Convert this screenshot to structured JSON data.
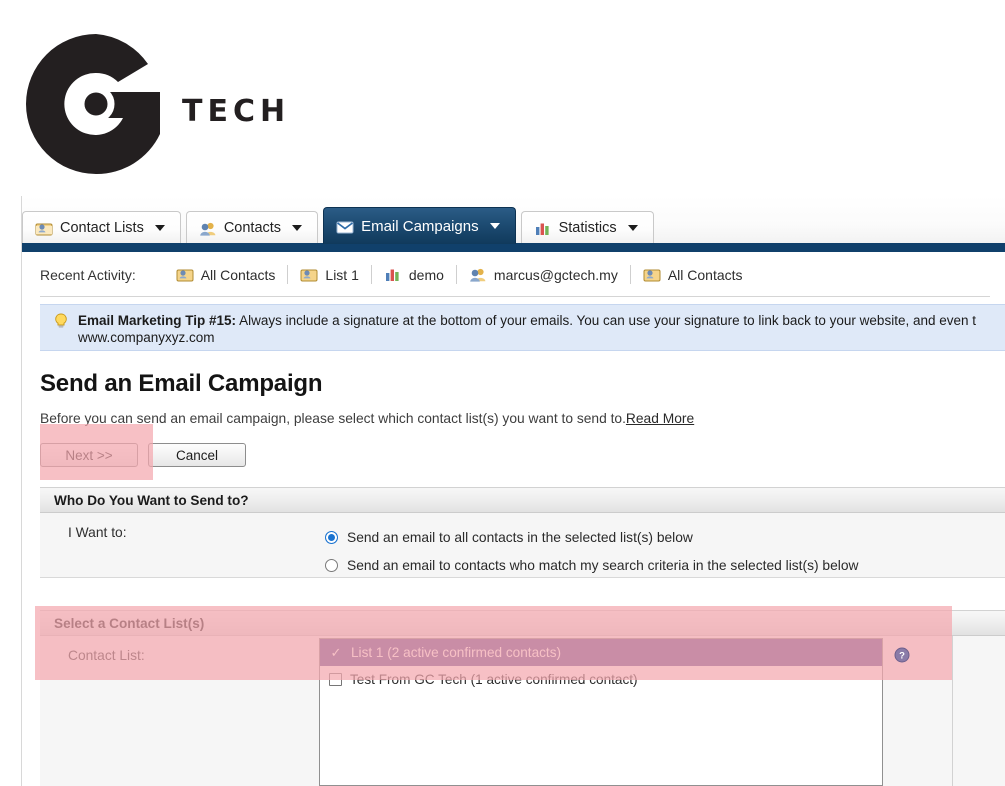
{
  "brand": {
    "logo_text": "TECH",
    "logo_icon": "gtech-g-logo-icon"
  },
  "tabs": [
    {
      "label": "Contact Lists",
      "icon": "contact-list-icon",
      "active": false
    },
    {
      "label": "Contacts",
      "icon": "contacts-icon",
      "active": false
    },
    {
      "label": "Email Campaigns",
      "icon": "envelope-icon",
      "active": true
    },
    {
      "label": "Statistics",
      "icon": "bar-chart-icon",
      "active": false
    }
  ],
  "recent_activity": {
    "label": "Recent Activity:",
    "items": [
      {
        "label": "All Contacts",
        "icon": "contact-list-icon"
      },
      {
        "label": "List 1",
        "icon": "contact-list-icon"
      },
      {
        "label": "demo",
        "icon": "bar-chart-icon"
      },
      {
        "label": "marcus@gctech.my",
        "icon": "contacts-icon"
      },
      {
        "label": "All Contacts",
        "icon": "contact-list-icon"
      }
    ]
  },
  "tip": {
    "icon": "lightbulb-icon",
    "title": "Email Marketing Tip #15:",
    "body": "Always include a signature at the bottom of your emails. You can use your signature to link back to your website, and even t",
    "second_line": "www.companyxyz.com"
  },
  "page": {
    "title": "Send an Email Campaign",
    "description": "Before you can send an email campaign, please select which contact list(s) you want to send to.",
    "read_more": "Read More"
  },
  "buttons": {
    "next": "Next >>",
    "cancel": "Cancel"
  },
  "sections": {
    "who": {
      "header": "Who Do You Want to Send to?",
      "field_label": "I Want to:",
      "options": [
        {
          "label": "Send an email to all contacts in the selected list(s) below",
          "selected": true
        },
        {
          "label": "Send an email to contacts who match my search criteria in the selected list(s) below",
          "selected": false
        }
      ]
    },
    "select_list": {
      "header": "Select a Contact List(s)",
      "field_label": "Contact List:",
      "help_icon": "help-question-icon",
      "items": [
        {
          "label": "List 1 (2 active confirmed contacts)",
          "checked": true,
          "selected": true
        },
        {
          "label": "Test From GC Tech (1 active confirmed contact)",
          "checked": false,
          "selected": false
        }
      ]
    }
  },
  "colors": {
    "active_tab": "#103a5c",
    "nav_strip": "#10406b",
    "tip_background": "#dfe9f8",
    "highlight_overlay": "#f4a8ae",
    "list_selected": "#5a4a8f",
    "radio_checked": "#1a73d0"
  }
}
